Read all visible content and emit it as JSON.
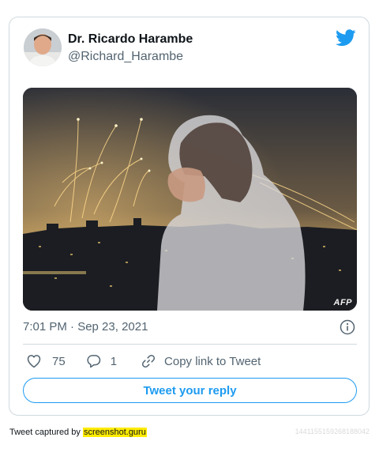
{
  "tweet": {
    "display_name": "Dr. Ricardo Harambe",
    "handle": "@Richard_Harambe",
    "media_watermark": "AFP",
    "timestamp": "7:01 PM · Sep 23, 2021",
    "likes": "75",
    "replies": "1",
    "copy_link_label": "Copy link to Tweet",
    "reply_button_label": "Tweet your reply"
  },
  "footer": {
    "captured_prefix": "Tweet captured by ",
    "captured_site": "screenshot.guru",
    "tweet_id": "1441155159268188042"
  },
  "colors": {
    "twitter_blue": "#1d9bf0",
    "border": "#cfd9de",
    "secondary_text": "#536471",
    "highlight": "#ffeb00"
  },
  "icons": [
    "twitter-bird-icon",
    "info-icon",
    "heart-icon",
    "reply-bubble-icon",
    "link-icon"
  ]
}
